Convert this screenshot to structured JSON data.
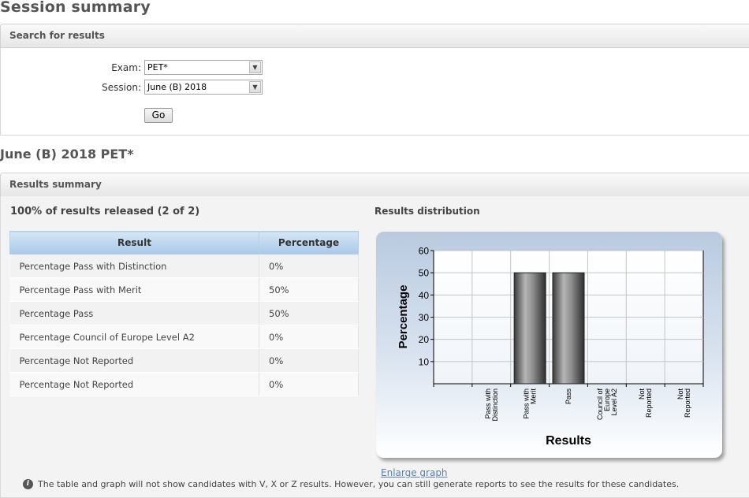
{
  "page": {
    "title": "Session summary"
  },
  "search": {
    "header": "Search for results",
    "exam_label": "Exam:",
    "exam_value": "PET*",
    "session_label": "Session:",
    "session_value": "June (B) 2018",
    "go_label": "Go"
  },
  "session_title": "June (B) 2018 PET*",
  "results": {
    "header": "Results summary",
    "released": "100% of results released (2 of 2)",
    "distribution_title": "Results distribution",
    "columns": [
      "Result",
      "Percentage"
    ],
    "rows": [
      {
        "result": "Percentage Pass with Distinction",
        "percentage": "0%"
      },
      {
        "result": "Percentage Pass with Merit",
        "percentage": "50%"
      },
      {
        "result": "Percentage Pass",
        "percentage": "50%"
      },
      {
        "result": "Percentage Council of Europe Level A2",
        "percentage": "0%"
      },
      {
        "result": "Percentage Not Reported",
        "percentage": "0%"
      },
      {
        "result": "Percentage Not Reported",
        "percentage": "0%"
      }
    ],
    "enlarge_link": "Enlarge graph",
    "footnote": "The table and graph will not show candidates with V, X or Z results. However, you can still generate reports to see the results for these candidates."
  },
  "icons": {
    "info": "info-icon",
    "dropdown": "chevron-down-icon"
  },
  "chart_data": {
    "type": "bar",
    "categories": [
      [
        "Pass with",
        "Distinction"
      ],
      [
        "Pass with",
        "Merit"
      ],
      [
        "Pass"
      ],
      [
        "Council of",
        "Europe",
        "Level A2"
      ],
      [
        "Not",
        "Reported"
      ],
      [
        "Not",
        "Reported"
      ]
    ],
    "values": [
      0,
      50,
      50,
      0,
      0,
      0
    ],
    "xlabel": "Results",
    "ylabel": "Percentage",
    "ylim": [
      0,
      60
    ],
    "yticks": [
      10,
      20,
      30,
      40,
      50,
      60
    ],
    "grid": true,
    "bar_color": "#6e6e6e"
  }
}
